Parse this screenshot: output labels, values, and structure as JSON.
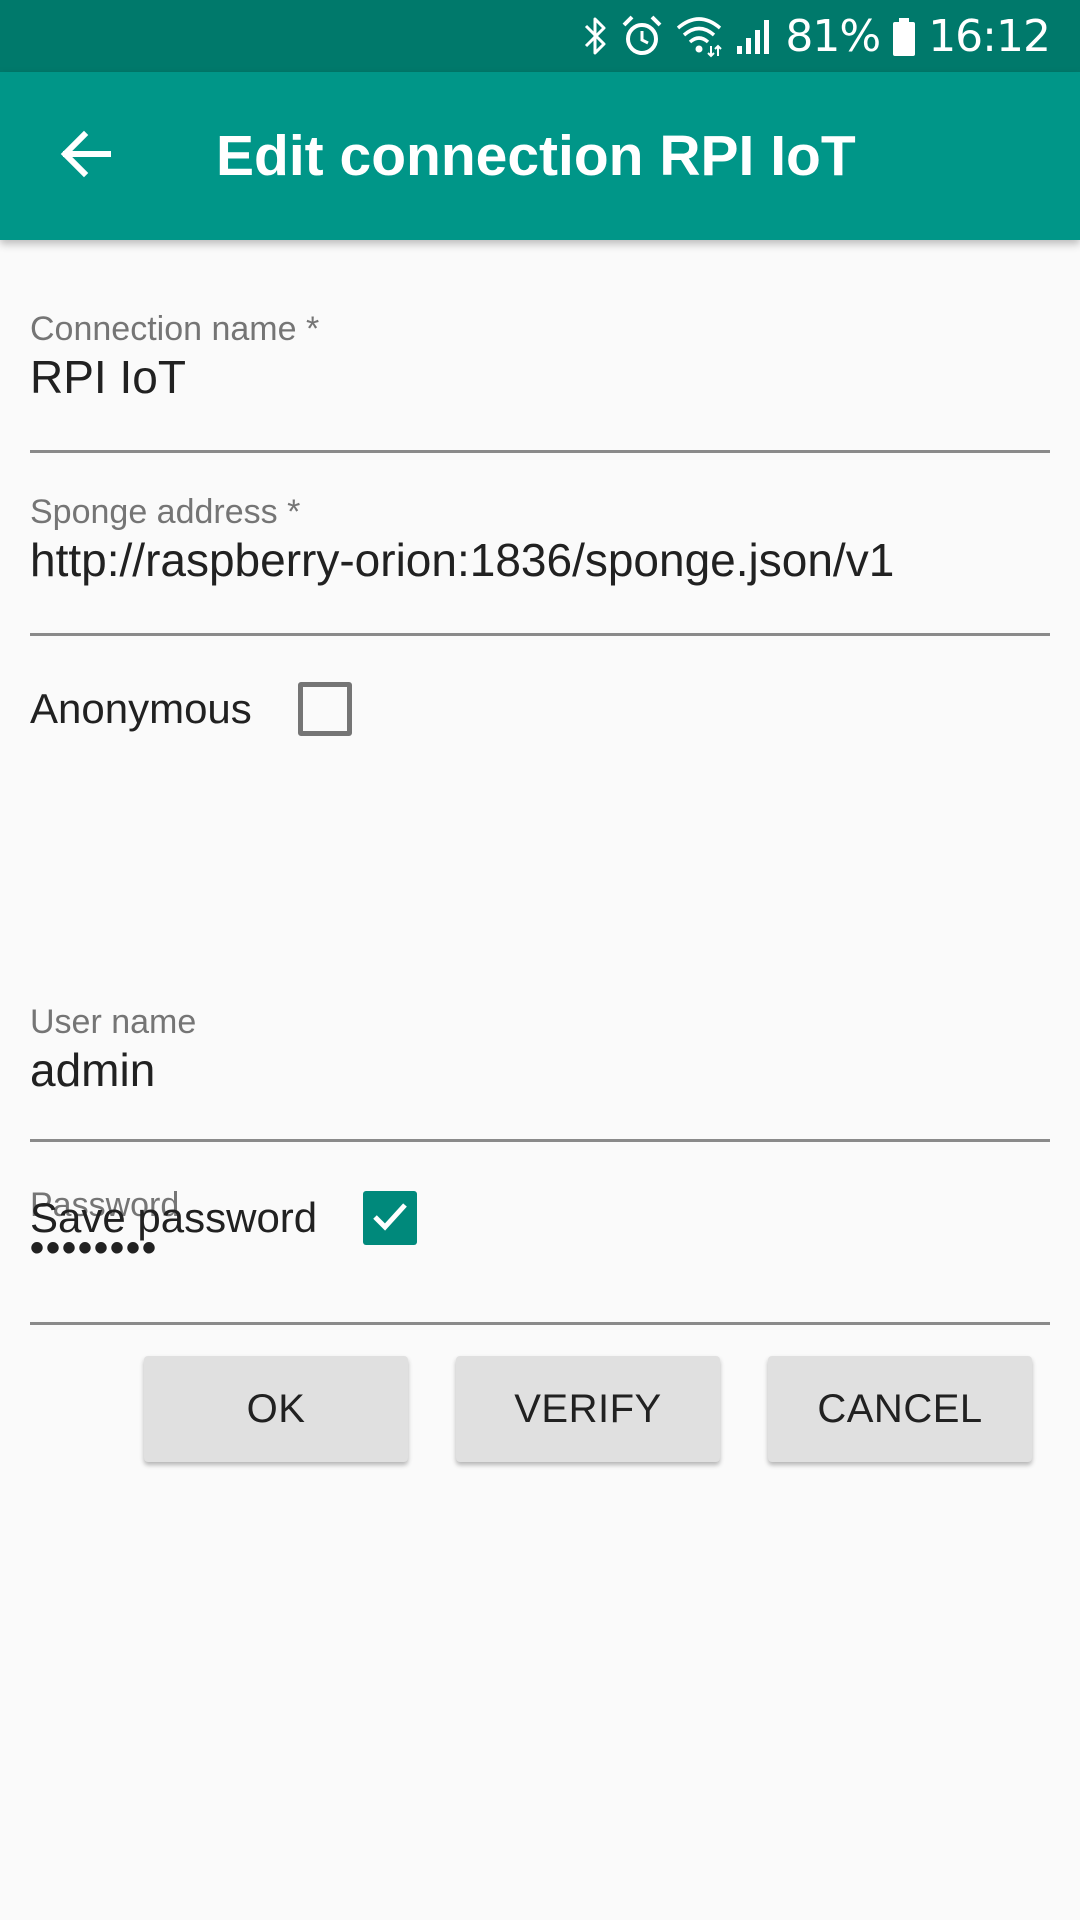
{
  "status_bar": {
    "icons": [
      "bluetooth-icon",
      "alarm-icon",
      "wifi-icon",
      "signal-icon",
      "battery-icon"
    ],
    "battery": "81%",
    "time": "16:12"
  },
  "app_bar": {
    "back_icon": "arrow-left-icon",
    "title": "Edit connection RPI IoT"
  },
  "form": {
    "connection_name": {
      "label": "Connection name *",
      "value": "RPI IoT"
    },
    "sponge_address": {
      "label": "Sponge address *",
      "value": "http://raspberry-orion:1836/sponge.json/v1"
    },
    "anonymous": {
      "label": "Anonymous",
      "checked": false
    },
    "user_name": {
      "label": "User name",
      "value": "admin"
    },
    "password": {
      "label": "Password",
      "value": "••••••••"
    },
    "save_password": {
      "label": "Save password",
      "checked": true
    }
  },
  "buttons": {
    "ok": "OK",
    "verify": "VERIFY",
    "cancel": "CANCEL"
  },
  "colors": {
    "status_bar": "#00796b",
    "app_bar": "#009688",
    "accent": "#00897b",
    "background": "#fafafa"
  }
}
